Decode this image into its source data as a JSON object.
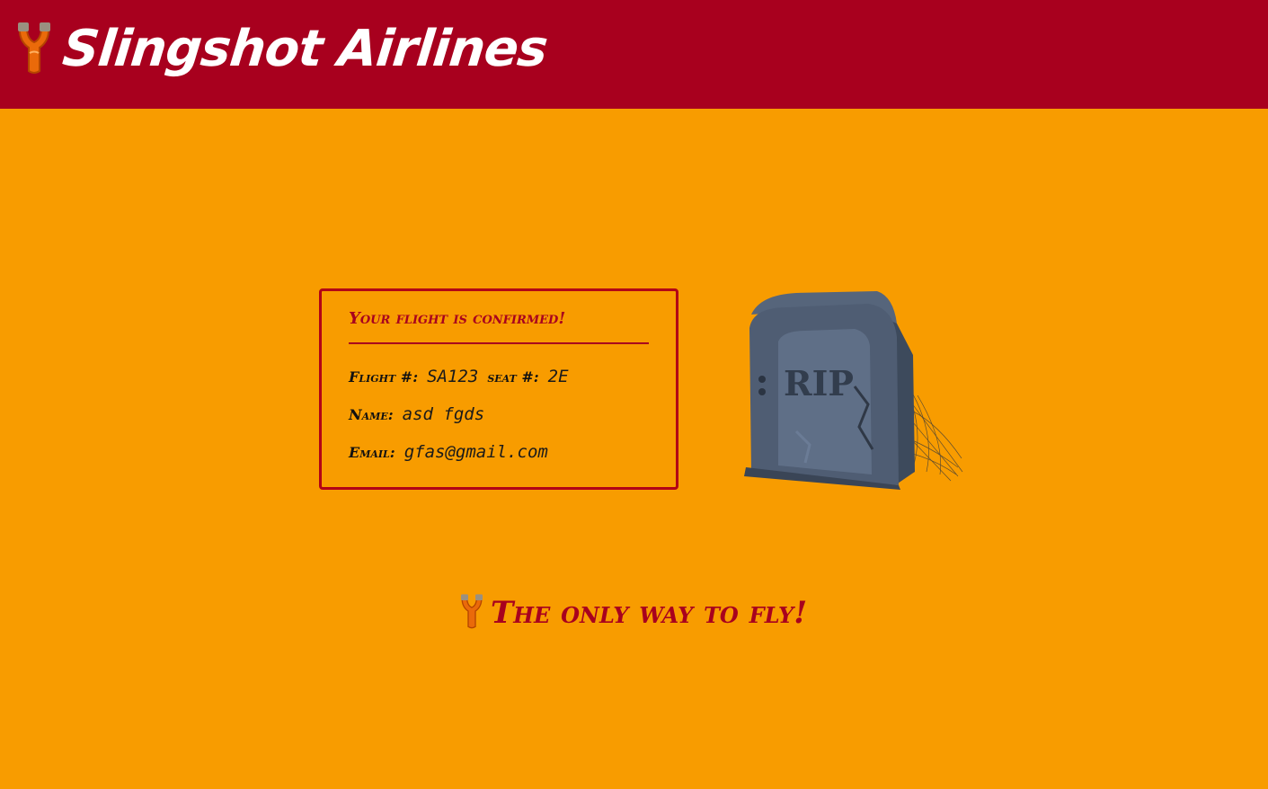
{
  "header": {
    "title": "Slingshot Airlines",
    "logo_icon": "slingshot-icon"
  },
  "confirmation": {
    "title": "Your flight is confirmed!",
    "flight_label": "Flight #:",
    "flight_value": "SA123",
    "seat_label": "seat #:",
    "seat_value": "2E",
    "name_label": "Name:",
    "name_value": "asd fgds",
    "email_label": "Email:",
    "email_value": "gfas@gmail.com"
  },
  "illustration": {
    "icon": "tombstone-icon",
    "text": "RIP"
  },
  "footer": {
    "tagline": "The only way to fly!",
    "icon": "slingshot-icon"
  },
  "colors": {
    "background": "#f89c00",
    "header": "#a8001e",
    "accent": "#b20016"
  }
}
